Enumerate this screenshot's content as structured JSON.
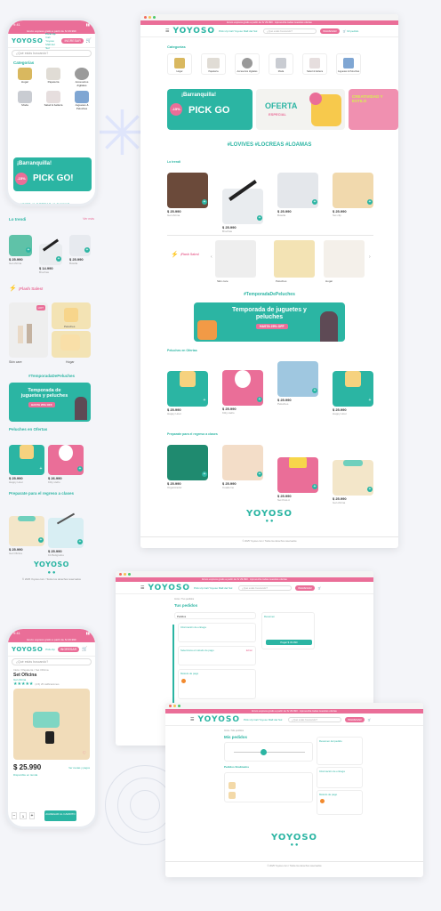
{
  "mobile_home": {
    "time": "9:41",
    "promo": "Envío express gratis a partir de S/ 29.990",
    "logo": "YOYOSO",
    "delivery_label": "Pick-Up",
    "delivery_value": "Cali Yoyoso Mall del Sol",
    "cta": "INGRESAR",
    "search_placeholder": "¿Qué estás buscando?",
    "categories_title": "Categorías",
    "categories": [
      "Hogar",
      "Papelería",
      "Accesorios digitales",
      "Moda",
      "Salud & belleza",
      "Juguetes & Peluches"
    ],
    "banner_title": "¡Barranquilla!",
    "banner_sub": "PICK GO!",
    "banner_discount": "-15%",
    "hashtags": "#LOVIVES #LOCREAS #LOAMAS",
    "trending_title": "Lo trendi",
    "see_all": "Ver más",
    "trending": [
      {
        "price": "$ 25.990",
        "name": "Gel oficina"
      },
      {
        "price": "$ 14.990",
        "name": "Brochas"
      },
      {
        "price": "$ 25.990",
        "name": "Botella"
      }
    ],
    "flash_title": "¡Flash Sales!",
    "flash_items": [
      "Skin care",
      "Peluches",
      "Hogar"
    ],
    "flash_badge": "HOT",
    "season_tag": "#TemporadaDePeluches",
    "season_banner_title": "Temporada de juguetes y peluches",
    "season_banner_sub": "HASTA 25% OFF",
    "plush_title": "Peluches en Ofertas",
    "plush": [
      {
        "price": "$ 25.990",
        "name": "Happy Hour"
      },
      {
        "price": "$ 26.990",
        "name": "Kitty Hello"
      }
    ],
    "school_title": "Preparate para el regreso a clases",
    "school": [
      {
        "price": "$ 25.990",
        "name": "Gel Oficina"
      },
      {
        "price": "$ 25.990",
        "name": "Kit Bolígrafos"
      }
    ],
    "footer_logo": "YOYOSO",
    "footer_text": "© 2025 Yoyoso.com / Todos los derechos reservados"
  },
  "desktop_home": {
    "promo": "Envío express gratis a partir de S/ 29.990 · Aprovecha todas nuestras ofertas",
    "logo": "YOYOSO",
    "delivery": "Pick-Up Cali Yoyoso Mall del Sol",
    "search_placeholder": "¿Qué estás buscando?",
    "cta": "INGRESAR",
    "cart": "Mi pedido",
    "categories_title": "Categorías",
    "categories": [
      "Hogar",
      "Papelería",
      "Accesorios digitales",
      "Moda",
      "Salud & belleza",
      "Juguetes & Peluches"
    ],
    "banner1_title": "¡Barranquilla!",
    "banner1_sub": "PICK GO",
    "banner1_discount": "-15%",
    "banner2_title": "OFERTA",
    "banner2_sub": "ESPECIAL",
    "banner3_title": "CREATIVIDAD Y ESTILO",
    "hashtags": "#LOVIVES #LOCREAS #LOAMAS",
    "trending_title": "Lo trendi",
    "trending": [
      {
        "price": "$ 25.990",
        "name": "Gel oficina"
      },
      {
        "price": "$ 25.990",
        "name": "Brochas"
      },
      {
        "price": "$ 25.990",
        "name": "Botella"
      },
      {
        "price": "$ 25.990",
        "name": "Set clip"
      }
    ],
    "flash_title": "¡Flash Sales!",
    "flash_items": [
      "Skin care",
      "Peluches",
      "Hogar"
    ],
    "season_tag": "#TemporadaDePeluches",
    "season_banner_title": "Temporada de juguetes y peluches",
    "season_banner_sub": "HASTA 25% OFF",
    "plush_title": "Peluches en Ofertas",
    "plush": [
      {
        "price": "$ 25.990",
        "name": "Happy Hour"
      },
      {
        "price": "$ 25.990",
        "name": "Kitty Hello"
      },
      {
        "price": "$ 25.990",
        "name": "Peluches"
      },
      {
        "price": "$ 25.990",
        "name": "Happy Hour"
      }
    ],
    "school_title": "Preparate para el regreso a clases",
    "school": [
      {
        "price": "$ 25.990",
        "name": "Organizador"
      },
      {
        "price": "$ 25.990",
        "name": "Cuaderno"
      },
      {
        "price": "$ 25.990",
        "name": "Set Post-it"
      },
      {
        "price": "$ 25.990",
        "name": "Gel oficina"
      }
    ],
    "footer_logo": "YOYOSO",
    "footer_text": "© 2025 Yoyoso.com / Todos los derechos reservados"
  },
  "orders_page": {
    "breadcrumb": "Inicio / Tus pedidos",
    "title": "Tus pedidos",
    "filter": "Pedidos",
    "summary_title": "Resumen",
    "pay_button": "Pagar $ 33.990",
    "steps": [
      "Información de entrega",
      "Selecciona el método de pago",
      "Método de pago"
    ],
    "edit": "Editar"
  },
  "myorders_page": {
    "breadcrumb": "Inicio / Mis pedidos",
    "title": "Mis pedidos",
    "section": "Pedidos finalizados",
    "summary_title": "Resumen del pedido",
    "delivery_title": "Información de entrega",
    "pay_title": "Método de pago",
    "footer_logo": "YOYOSO",
    "footer_text": "© 2025 Yoyoso.com / Todos los derechos reservados"
  },
  "mobile_product": {
    "time": "9:41",
    "breadcrumb": "Inicio / Papelería / Set Oficina",
    "name": "Set Oficina",
    "brand": "Gel oficina",
    "rating_text": "(4.5) 25 calificaciones",
    "price": "$ 25.990",
    "price_note": "Ver cuotas y pagos",
    "stock_note": "Disponible en tienda",
    "qty": "1",
    "add_button": "AGREGAR AL CARRITO"
  },
  "colors": {
    "brand_teal": "#2bb5a3",
    "brand_pink": "#ea6e98"
  }
}
